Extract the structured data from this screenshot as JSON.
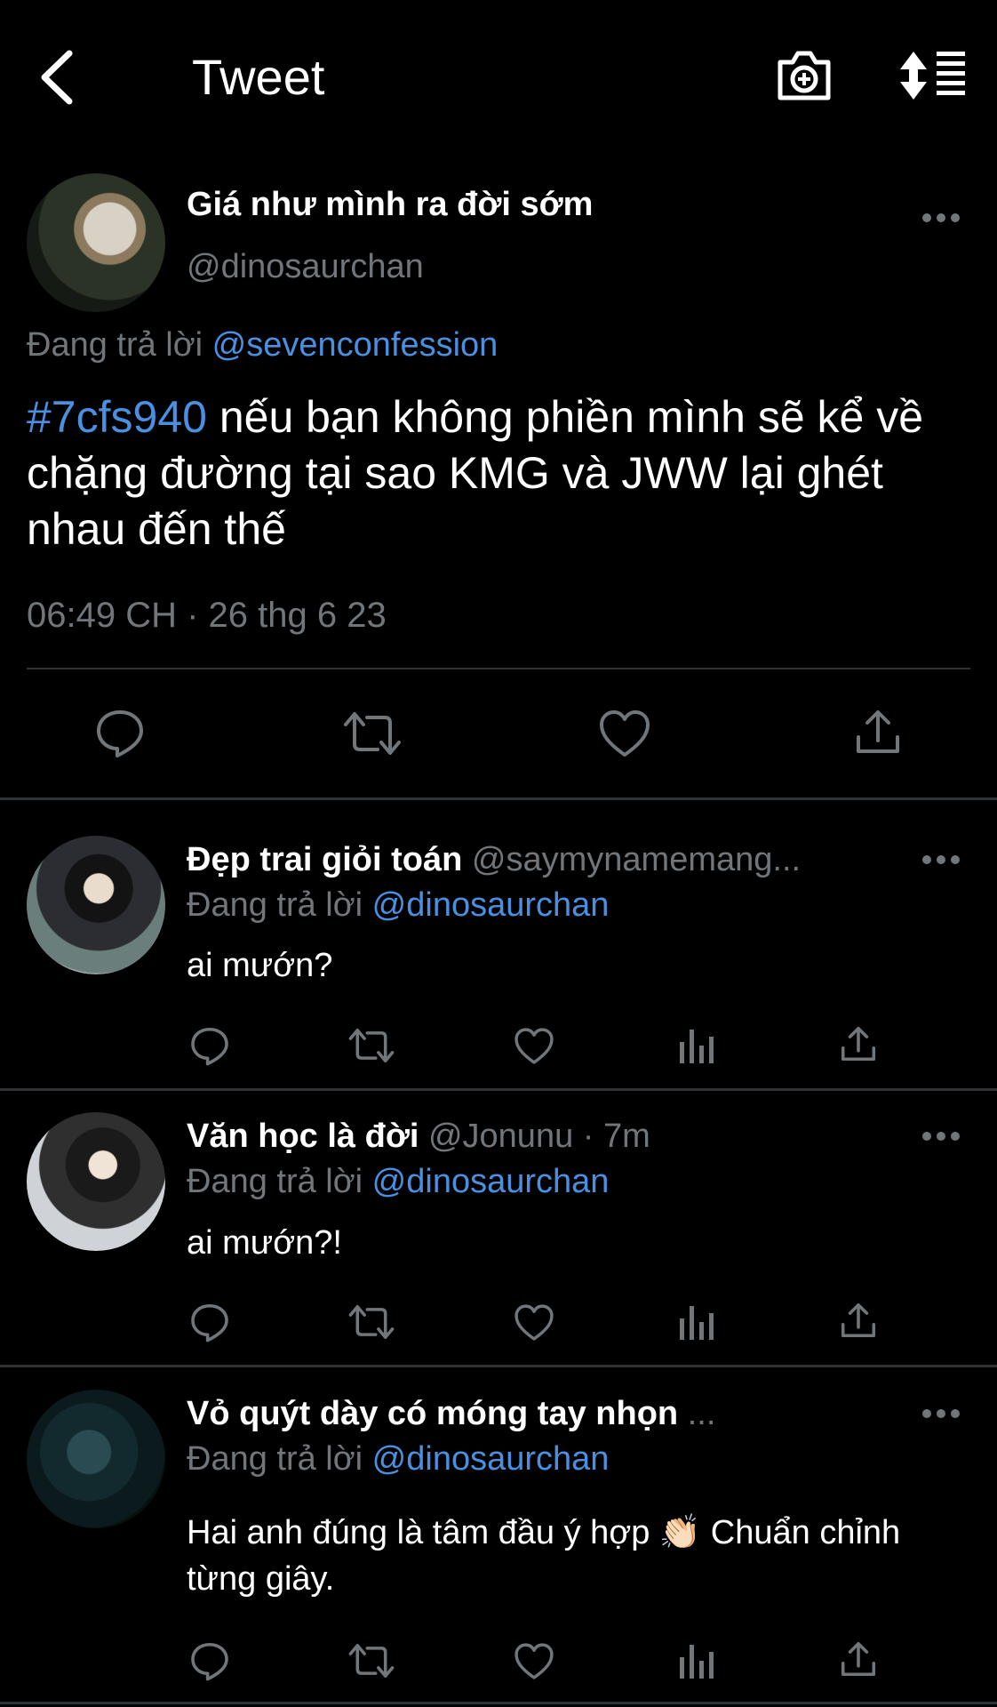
{
  "header": {
    "title": "Tweet",
    "back_icon": "chevron-left-icon",
    "camera_icon": "camera-plus-icon",
    "sort_icon": "sort-icon"
  },
  "tweet": {
    "author_name": "Giá như mình ra đời sớm",
    "author_handle": "@dinosaurchan",
    "replying_prefix": "Đang trả lời",
    "replying_to": "@sevenconfession",
    "hashtag": "#7cfs940",
    "text": " nếu bạn không phiền mình sẽ kể về chặng đường tại sao KMG và JWW lại ghét nhau đến thế",
    "timestamp": "06:49 CH · 26 thg 6 23"
  },
  "replies": [
    {
      "name": "Đẹp trai giỏi toán",
      "meta": "@saymynamemang...",
      "replying_prefix": "Đang trả lời",
      "replying_to": "@dinosaurchan",
      "text": "ai mướn?"
    },
    {
      "name": "Văn học là đời",
      "meta": "@Jonunu · 7m",
      "replying_prefix": "Đang trả lời",
      "replying_to": "@dinosaurchan",
      "text": "ai mướn?!"
    },
    {
      "name": "Vỏ quýt dày có móng tay nhọn",
      "meta": "...",
      "replying_prefix": "Đang trả lời",
      "replying_to": "@dinosaurchan",
      "text": "Hai anh đúng là tâm đầu ý hợp 👏🏻  Chuẩn chỉnh từng giây."
    }
  ],
  "colors": {
    "background": "#000000",
    "text": "#ffffff",
    "muted": "#71767b",
    "link": "#4a8fe0",
    "divider": "#2f3336"
  }
}
